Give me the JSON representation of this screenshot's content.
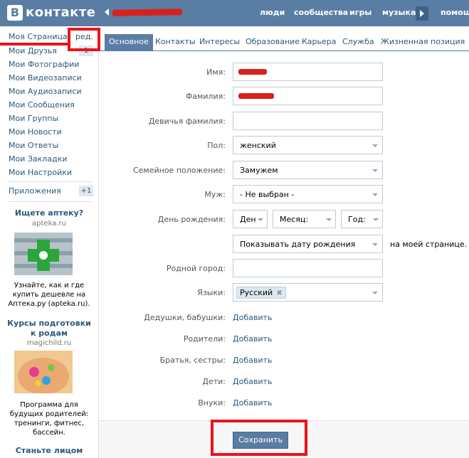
{
  "header": {
    "logo_letter": "В",
    "logo_text": "контакте",
    "nav": [
      "люди",
      "сообщества",
      "игры",
      "музыка",
      "помощь"
    ]
  },
  "sidebar": {
    "items": [
      {
        "label": "Моя Страница"
      },
      {
        "label": "Мои Друзья"
      },
      {
        "label": "Мои Фотографии"
      },
      {
        "label": "Мои Видеозаписи"
      },
      {
        "label": "Мои Аудиозаписи"
      },
      {
        "label": "Мои Сообщения"
      },
      {
        "label": "Мои Группы"
      },
      {
        "label": "Мои Новости"
      },
      {
        "label": "Мои Ответы"
      },
      {
        "label": "Мои Закладки"
      },
      {
        "label": "Мои Настройки"
      }
    ],
    "edit_label": "ред.",
    "apps_label": "Приложения",
    "apps_count": "+1",
    "friends_count": "1"
  },
  "ads": [
    {
      "title": "Ищете аптеку?",
      "domain": "apteka.ru",
      "text": "Узнайте, как и где купить дешевле на Аптека.ру (apteka.ru)."
    },
    {
      "title": "Курсы подготовки к родам",
      "domain": "magichild.ru",
      "text": "Программа для будущих родителей: тренинги, фитнес, бассейн."
    },
    {
      "title": "Станьте лицом"
    }
  ],
  "tabs": [
    "Основное",
    "Контакты",
    "Интересы",
    "Образование",
    "Карьера",
    "Служба",
    "Жизненная позиция"
  ],
  "form": {
    "first_name_label": "Имя:",
    "last_name_label": "Фамилия:",
    "maiden_label": "Девичья фамилия:",
    "gender_label": "Пол:",
    "gender_value": "женский",
    "marital_label": "Семейное положение:",
    "marital_value": "Замужем",
    "husband_label": "Муж:",
    "husband_value": "- Не выбран -",
    "birthday_label": "День рождения:",
    "day_value": "Ден",
    "month_value": "Месяц:",
    "year_value": "Год:",
    "show_birthday_value": "Показывать дату рождения",
    "show_birthday_suffix": "на моей странице.",
    "hometown_label": "Родной город:",
    "languages_label": "Языки:",
    "language_chip": "Русский",
    "grandparents_label": "Дедушки, бабушки:",
    "parents_label": "Родители:",
    "siblings_label": "Братья, сестры:",
    "children_label": "Дети:",
    "grandchildren_label": "Внуки:",
    "add_label": "Добавить",
    "save_label": "Сохранить"
  },
  "colors": {
    "brand_blue": "#597da3",
    "link_blue": "#2b587a",
    "annotation_red": "#e8151a"
  }
}
